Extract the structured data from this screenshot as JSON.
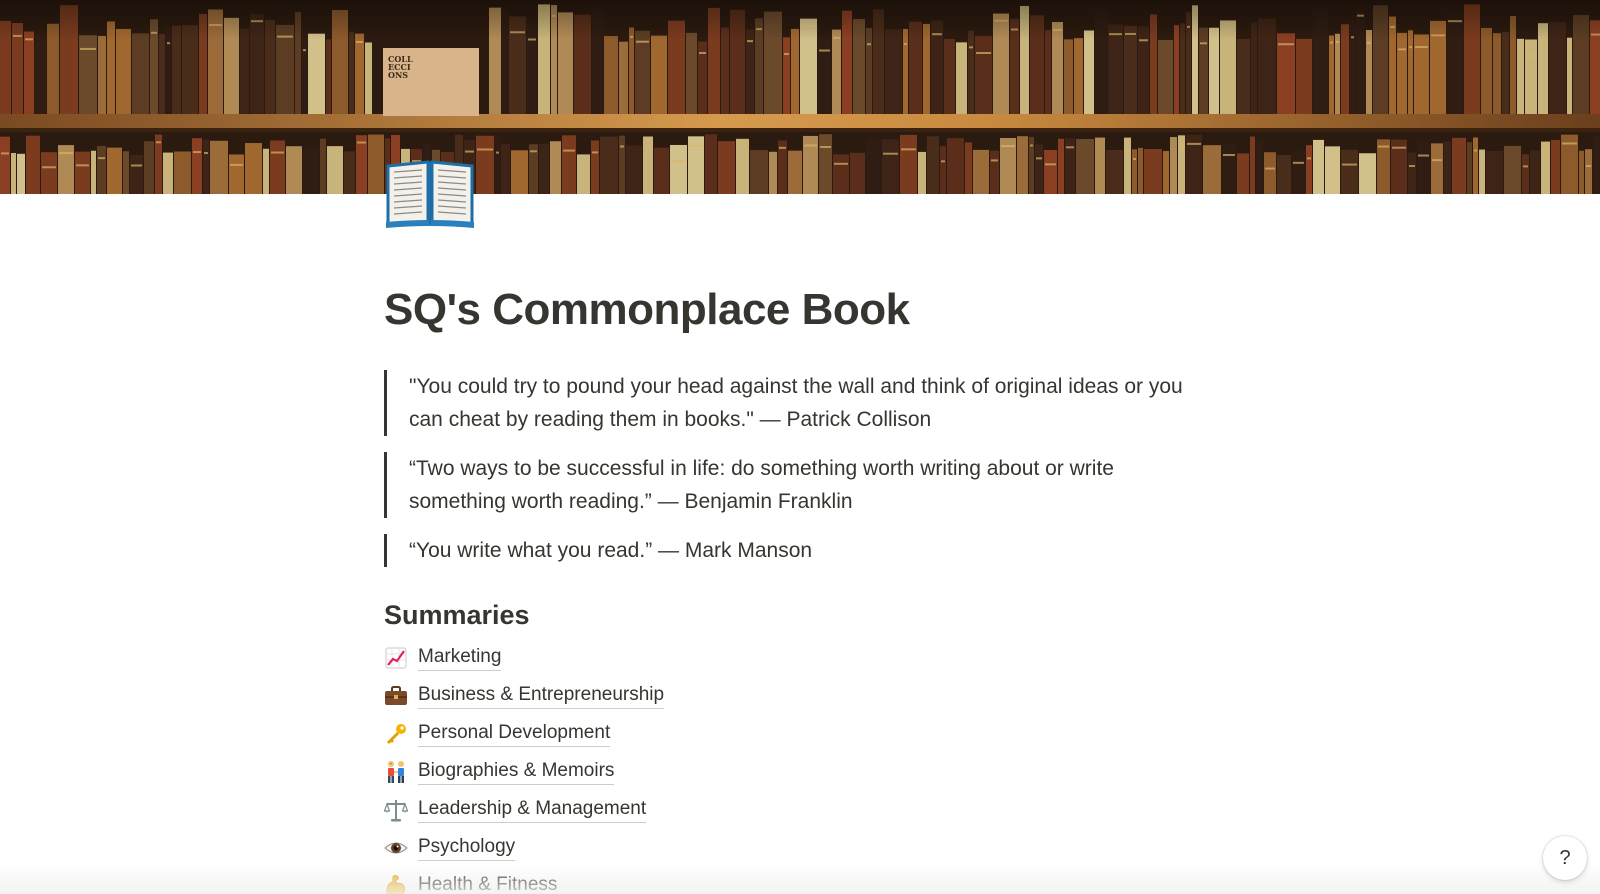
{
  "page": {
    "title": "SQ's Commonplace Book",
    "icon": "open-book-icon",
    "cover": "bookshelf-photo"
  },
  "quotes": [
    {
      "text": "\"You could try to pound your head against the wall and think of original ideas or you can cheat by reading them in books.\" — Patrick Collison"
    },
    {
      "text": "“Two ways to be successful in life: do something worth writing about or write something worth reading.” — Benjamin Franklin"
    },
    {
      "text": "“You write what you read.” — Mark Manson"
    }
  ],
  "summaries": {
    "heading": "Summaries",
    "items": [
      {
        "label": "Marketing",
        "icon": "chart-increasing-icon"
      },
      {
        "label": "Business & Entrepreneurship",
        "icon": "briefcase-icon"
      },
      {
        "label": "Personal Development",
        "icon": "key-icon"
      },
      {
        "label": "Biographies & Memoirs",
        "icon": "people-holding-hands-icon"
      },
      {
        "label": "Leadership & Management",
        "icon": "balance-scale-icon"
      },
      {
        "label": "Psychology",
        "icon": "eye-icon"
      },
      {
        "label": "Health & Fitness",
        "icon": "flexed-biceps-icon"
      }
    ]
  },
  "help": {
    "label": "?"
  },
  "colors": {
    "text": "#37352f",
    "quote_bar": "#37352f",
    "background": "#ffffff"
  }
}
